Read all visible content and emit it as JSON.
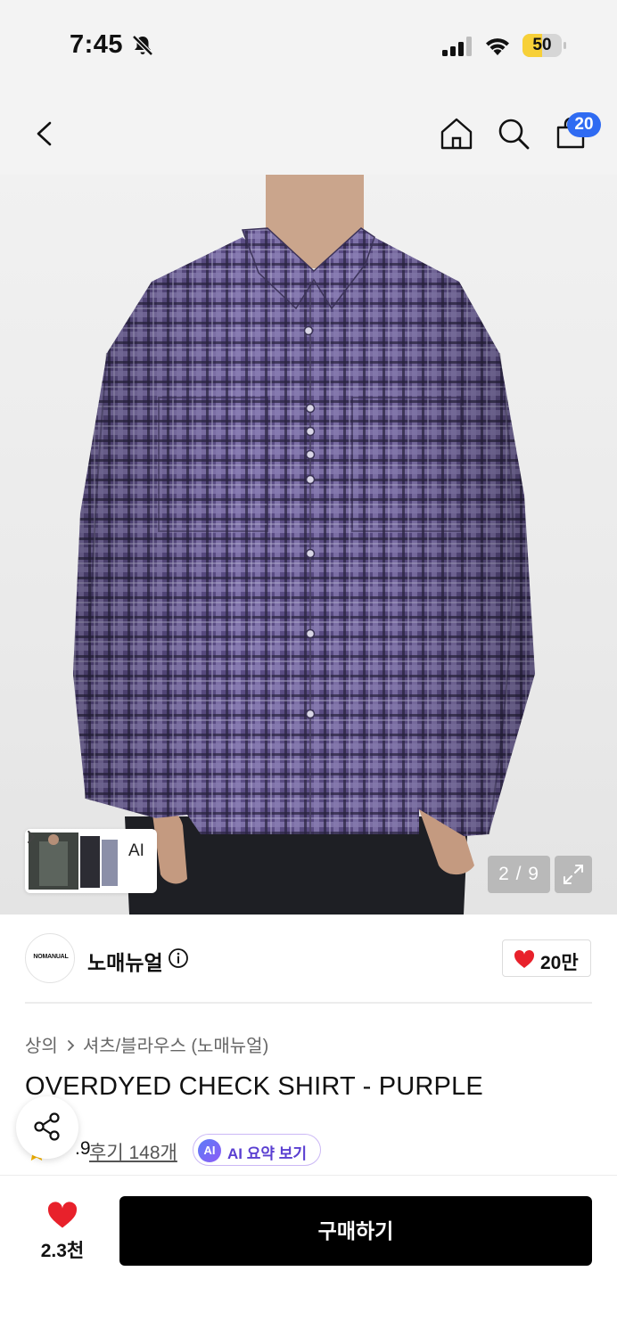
{
  "status_bar": {
    "time": "7:45",
    "battery": "50",
    "battery_level_percent": 50,
    "icons": [
      "bell-slash-icon",
      "signal-icon",
      "wifi-icon",
      "battery-icon"
    ]
  },
  "nav": {
    "icons": [
      "back-arrow-icon",
      "home-icon",
      "search-icon",
      "bag-icon"
    ],
    "cart_count": "20"
  },
  "gallery": {
    "counter": "2 / 9",
    "ai_label": "AI",
    "image_subject": "model wearing oversized purple check shirt"
  },
  "brand": {
    "logo_text": "NOMANUAL",
    "name": "노매뉴얼",
    "likes": "20만"
  },
  "product": {
    "breadcrumb": [
      "상의",
      "셔츠/블라우스 (노매뉴얼)"
    ],
    "title": "OVERDYED CHECK SHIRT - PURPLE",
    "rating": ".9",
    "reviews": "후기 148개",
    "ai_summary": "AI 요약 보기",
    "ai_badge": "AI"
  },
  "bottom": {
    "wishlist_count": "2.3천",
    "buy_label": "구매하기"
  },
  "colors": {
    "accent_blue": "#2f6bf2",
    "heart_red": "#e8212b",
    "buy_black": "#000000",
    "ai_purple": "#5a3fd1",
    "battery_yellow": "#f7d038"
  }
}
